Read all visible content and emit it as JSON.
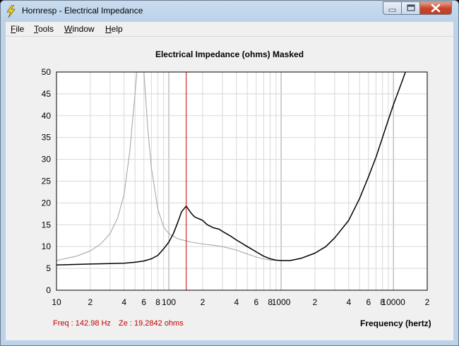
{
  "window": {
    "title": "Hornresp - Electrical Impedance",
    "icon": "lightning-bolt-icon",
    "controls": [
      "minimize-icon",
      "maximize-icon",
      "close-icon"
    ]
  },
  "menu": [
    {
      "accel": "F",
      "rest": "ile"
    },
    {
      "accel": "T",
      "rest": "ools"
    },
    {
      "accel": "W",
      "rest": "indow"
    },
    {
      "accel": "H",
      "rest": "elp"
    }
  ],
  "chart": {
    "title": "Electrical Impedance (ohms)   Masked",
    "xlabel": "Frequency (hertz)"
  },
  "readout": {
    "freq": "Freq : 142.98 Hz",
    "ze": "Ze : 19.2842 ohms"
  },
  "colors": {
    "main_trace": "#000000",
    "masked_trace": "#a8a8a8",
    "cursor": "#c00000"
  },
  "chart_data": {
    "type": "line",
    "x_scale": "log",
    "xlim": [
      10,
      20000
    ],
    "ylim": [
      0,
      50
    ],
    "y_ticks": [
      0,
      5,
      10,
      15,
      20,
      25,
      30,
      35,
      40,
      45,
      50
    ],
    "x_tick_labels": [
      {
        "v": 10,
        "t": "10"
      },
      {
        "v": 20,
        "t": "2"
      },
      {
        "v": 40,
        "t": "4"
      },
      {
        "v": 60,
        "t": "6"
      },
      {
        "v": 80,
        "t": "8"
      },
      {
        "v": 100,
        "t": "100"
      },
      {
        "v": 200,
        "t": "2"
      },
      {
        "v": 400,
        "t": "4"
      },
      {
        "v": 600,
        "t": "6"
      },
      {
        "v": 800,
        "t": "8"
      },
      {
        "v": 1000,
        "t": "1000"
      },
      {
        "v": 2000,
        "t": "2"
      },
      {
        "v": 4000,
        "t": "4"
      },
      {
        "v": 6000,
        "t": "6"
      },
      {
        "v": 8000,
        "t": "8"
      },
      {
        "v": 10000,
        "t": "10000"
      },
      {
        "v": 20000,
        "t": "2"
      }
    ],
    "cursor_x": 142.98,
    "grid": true,
    "series": [
      {
        "role": "main",
        "x": [
          10,
          20,
          30,
          40,
          50,
          60,
          70,
          80,
          90,
          100,
          110,
          120,
          130,
          142.98,
          150,
          160,
          170,
          180,
          200,
          220,
          250,
          280,
          300,
          350,
          400,
          500,
          600,
          700,
          800,
          900,
          1000,
          1200,
          1500,
          2000,
          2500,
          3000,
          4000,
          5000,
          6000,
          7000,
          8000,
          9000,
          10000,
          12000,
          15000
        ],
        "y": [
          5.8,
          6.0,
          6.1,
          6.2,
          6.4,
          6.7,
          7.2,
          8.0,
          9.5,
          11.0,
          13.0,
          15.5,
          18.0,
          19.28,
          18.5,
          17.5,
          16.8,
          16.5,
          16.0,
          15.0,
          14.3,
          14.0,
          13.5,
          12.5,
          11.5,
          10.0,
          8.8,
          7.8,
          7.2,
          6.9,
          6.8,
          6.8,
          7.3,
          8.5,
          10.0,
          12.0,
          16.0,
          21.0,
          26.0,
          30.5,
          35.0,
          39.0,
          42.5,
          48.0,
          55.0
        ]
      },
      {
        "role": "masked",
        "x": [
          10,
          15,
          20,
          25,
          30,
          35,
          40,
          45,
          50,
          52,
          55,
          60,
          65,
          70,
          80,
          90,
          100,
          120,
          142.98,
          160,
          200,
          250,
          300,
          400,
          500,
          600,
          700,
          800,
          1000
        ],
        "y": [
          6.8,
          7.8,
          9.0,
          10.7,
          13.0,
          16.5,
          22.0,
          32.0,
          45.0,
          50.0,
          55.0,
          50.0,
          37.0,
          28.0,
          18.5,
          14.5,
          13.0,
          11.8,
          11.3,
          11.0,
          10.6,
          10.3,
          10.0,
          9.2,
          8.3,
          7.6,
          7.2,
          6.9,
          6.8
        ]
      }
    ]
  }
}
